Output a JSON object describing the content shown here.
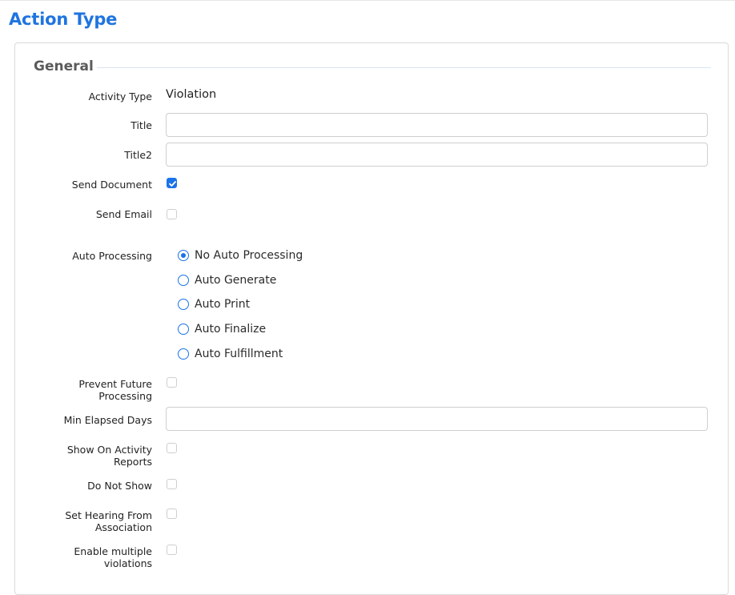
{
  "page": {
    "title": "Action Type"
  },
  "section": {
    "title": "General"
  },
  "fields": {
    "activity_type": {
      "label": "Activity Type",
      "value": "Violation"
    },
    "title": {
      "label": "Title",
      "value": "",
      "placeholder": ""
    },
    "title2": {
      "label": "Title2",
      "value": "",
      "placeholder": ""
    },
    "send_document": {
      "label": "Send Document",
      "checked": true
    },
    "send_email": {
      "label": "Send Email",
      "checked": false
    },
    "auto_processing": {
      "label": "Auto Processing",
      "selected": "No Auto Processing",
      "options": [
        "No Auto Processing",
        "Auto Generate",
        "Auto Print",
        "Auto Finalize",
        "Auto Fulfillment"
      ]
    },
    "prevent_future_processing": {
      "label_line1": "Prevent Future",
      "label_line2": "Processing",
      "checked": false
    },
    "min_elapsed_days": {
      "label": "Min Elapsed Days",
      "value": "",
      "placeholder": ""
    },
    "show_on_activity_reports": {
      "label_line1": "Show On Activity",
      "label_line2": "Reports",
      "checked": false
    },
    "do_not_show": {
      "label": "Do Not Show",
      "checked": false
    },
    "set_hearing_from_association": {
      "label_line1": "Set Hearing From",
      "label_line2": "Association",
      "checked": false
    },
    "enable_multiple_violations": {
      "label_line1": "Enable multiple",
      "label_line2": "violations",
      "checked": false
    }
  },
  "colors": {
    "accent": "#1a73e8",
    "title": "#1f74e0"
  },
  "icons": {
    "checkmark": "check-icon"
  }
}
